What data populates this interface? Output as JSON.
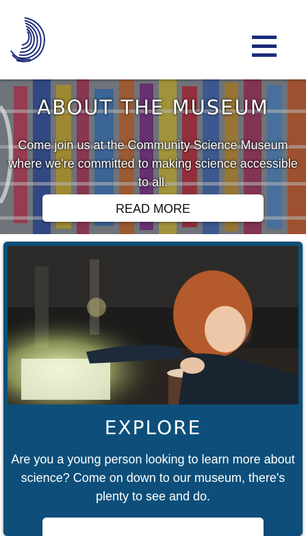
{
  "header": {
    "logo_icon": "spiral-logo-icon",
    "menu_icon": "hamburger-menu-icon",
    "brand_color": "#1a2a78"
  },
  "hero": {
    "title": "ABOUT THE MUSEUM",
    "text": "Come join us at the Community Science Museum where we're committed to making science accessible to all.",
    "button_label": "READ MORE"
  },
  "explore": {
    "title": "EXPLORE",
    "text": "Are you a young person looking to learn more about science? Come on down to our museum, there's plenty to see and do.",
    "button_label": "",
    "card_color": "#0d4f7a"
  }
}
